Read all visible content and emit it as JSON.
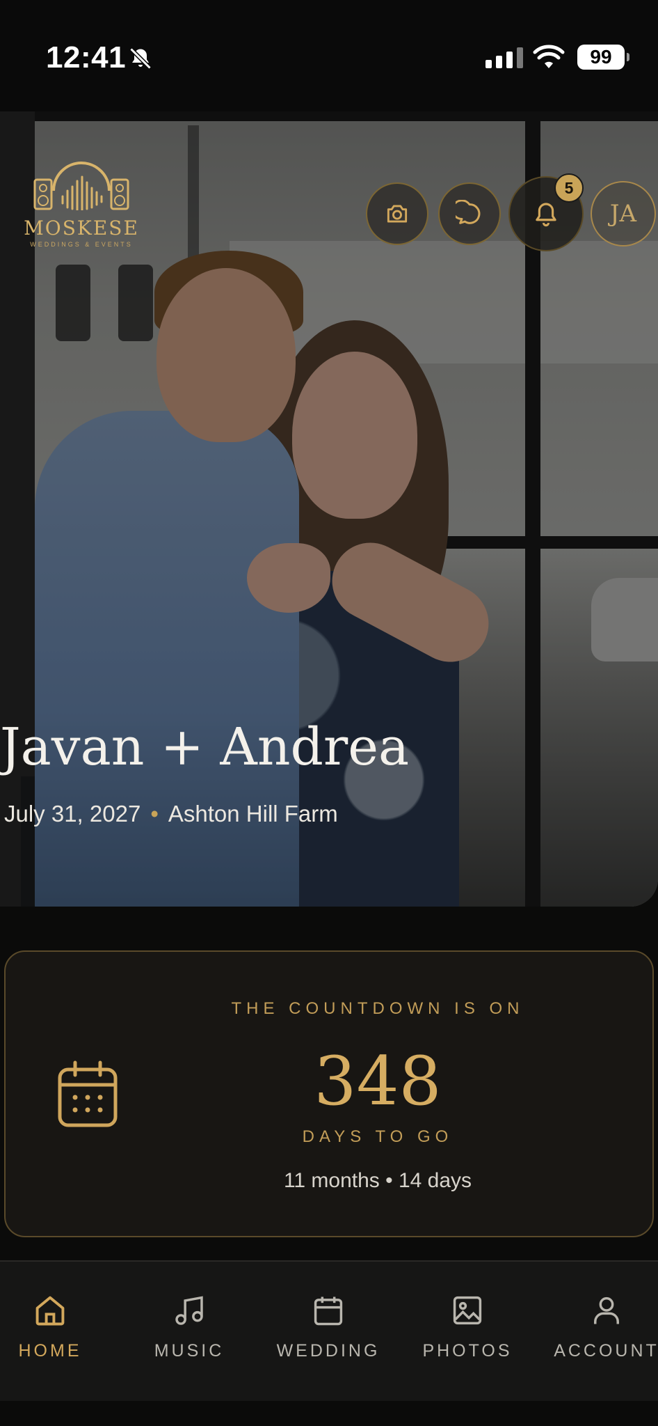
{
  "status_bar": {
    "time": "12:41",
    "battery": "99"
  },
  "brand": {
    "name": "MOSKESE",
    "tagline": "WEDDINGS & EVENTS"
  },
  "header_actions": {
    "notification_count": "5",
    "avatar_initials": "JA"
  },
  "hero": {
    "names": "Javan + Andrea",
    "date": "July 31, 2027",
    "separator": "•",
    "venue": "Ashton Hill Farm"
  },
  "countdown": {
    "heading": "THE COUNTDOWN IS ON",
    "days": "348",
    "days_label": "DAYS TO GO",
    "detail": "11 months • 14 days"
  },
  "nav": {
    "items": [
      {
        "label": "HOME",
        "icon": "home-icon",
        "active": true
      },
      {
        "label": "MUSIC",
        "icon": "music-note-icon",
        "active": false
      },
      {
        "label": "WEDDING",
        "icon": "calendar-icon",
        "active": false
      },
      {
        "label": "PHOTOS",
        "icon": "image-icon",
        "active": false
      },
      {
        "label": "ACCOUNT",
        "icon": "person-icon",
        "active": false
      }
    ]
  },
  "colors": {
    "accent": "#c9a458",
    "background": "#0b0b0a",
    "card": "#181613"
  }
}
